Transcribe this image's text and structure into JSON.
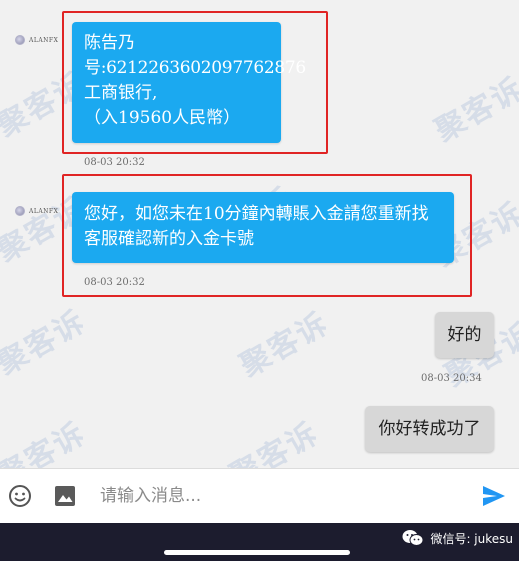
{
  "watermark": "聚客诉",
  "contact": {
    "name": "ALANFX"
  },
  "messages": [
    {
      "direction": "incoming",
      "lines": [
        "陈告乃",
        "号:6212263602097762876",
        "工商银行,",
        "（入19560人民幣）"
      ],
      "time": "08-03 20:32",
      "highlighted": true
    },
    {
      "direction": "incoming",
      "lines": [
        "您好，如您未在10分鐘內轉賬入金請您重新找",
        "客服確認新的入金卡號"
      ],
      "time": "08-03 20:32",
      "highlighted": true
    },
    {
      "direction": "outgoing",
      "lines": [
        "好的"
      ],
      "time": "08-03 20:34"
    },
    {
      "direction": "outgoing",
      "lines": [
        "你好转成功了"
      ]
    }
  ],
  "input": {
    "placeholder": "请输入消息..."
  },
  "icons": {
    "emoji": "emoji-icon",
    "image": "image-icon",
    "send": "send-icon",
    "wechat": "wechat-icon"
  },
  "footer": {
    "wechat_label": "微信号: jukesu"
  },
  "colors": {
    "incoming_bubble": "#1ba9f0",
    "outgoing_bubble": "#d7d7d7",
    "highlight_box": "#e02424",
    "send_button": "#2196f3",
    "bottom_bar": "#1c1c2e"
  }
}
